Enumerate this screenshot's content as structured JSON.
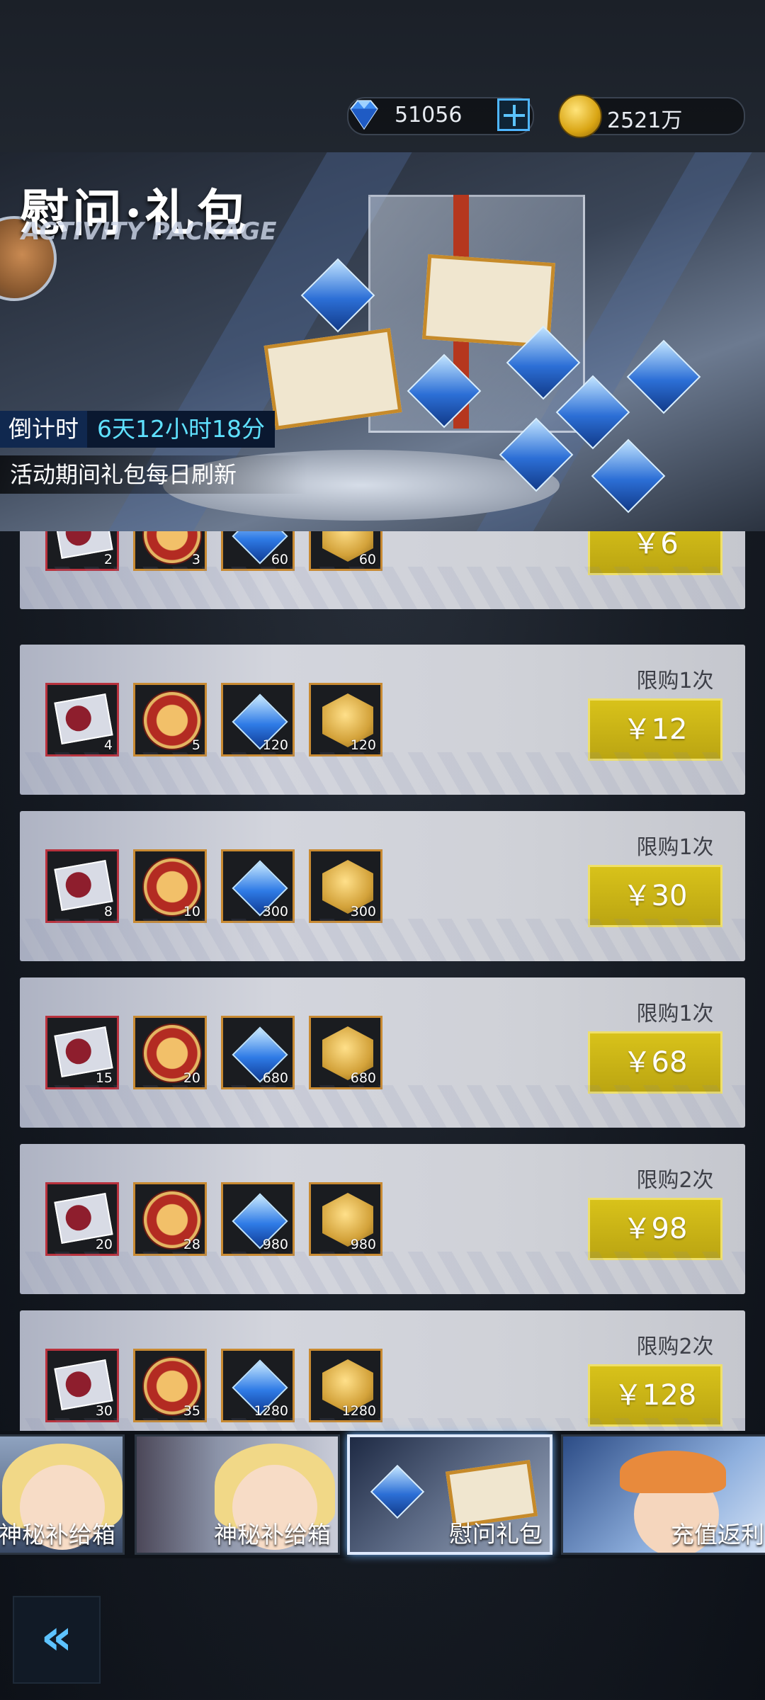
{
  "currency": {
    "gems": "51056",
    "gold": "2521万"
  },
  "banner": {
    "title": "慰问·礼包",
    "subtitle": "ACTIVITY PACKAGE",
    "countdown_label": "倒计时",
    "countdown_value": "6天12小时18分",
    "refresh_note": "活动期间礼包每日刷新"
  },
  "packages": [
    {
      "items": [
        "2",
        "3",
        "60",
        "60"
      ],
      "limit": "",
      "price": "￥6"
    },
    {
      "items": [
        "4",
        "5",
        "120",
        "120"
      ],
      "limit": "限购1次",
      "price": "￥12"
    },
    {
      "items": [
        "8",
        "10",
        "300",
        "300"
      ],
      "limit": "限购1次",
      "price": "￥30"
    },
    {
      "items": [
        "15",
        "20",
        "680",
        "680"
      ],
      "limit": "限购1次",
      "price": "￥68"
    },
    {
      "items": [
        "20",
        "28",
        "980",
        "980"
      ],
      "limit": "限购2次",
      "price": "￥98"
    },
    {
      "items": [
        "30",
        "35",
        "1280",
        "1280"
      ],
      "limit": "限购2次",
      "price": "￥128"
    }
  ],
  "tabs": [
    {
      "label": "神秘补给箱",
      "active": false
    },
    {
      "label": "神秘补给箱",
      "active": false
    },
    {
      "label": "慰问礼包",
      "active": true
    },
    {
      "label": "充值返利",
      "active": false
    }
  ],
  "colors": {
    "price_button": "#c9b414",
    "countdown_value": "#5fe1ff",
    "accent_blue": "#5dc3ff"
  },
  "icons": [
    "gem-icon",
    "coin-icon",
    "plus-icon",
    "photo-card-icon",
    "bear-medal-icon",
    "diamond-icon",
    "gold-hex-icon",
    "double-chevron-left-icon"
  ]
}
